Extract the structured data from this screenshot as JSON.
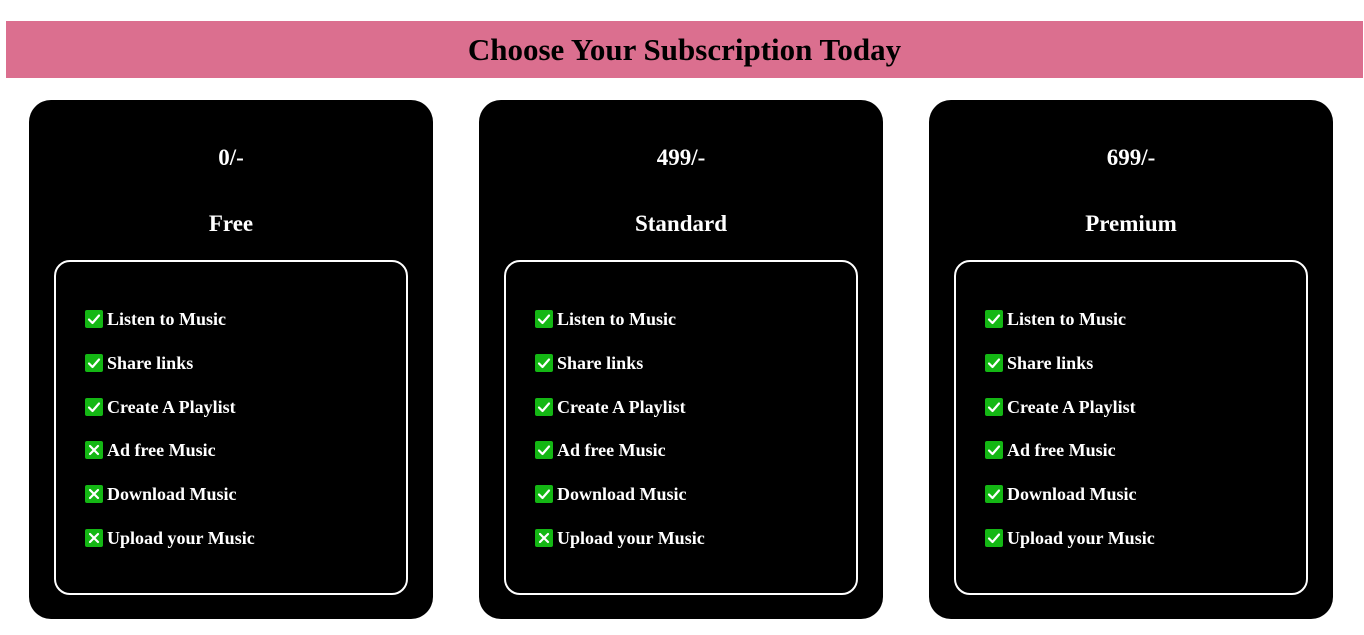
{
  "header": {
    "title": "Choose Your Subscription Today"
  },
  "colors": {
    "header_bg": "#db6f8f",
    "card_bg": "#000000",
    "check_bg": "#14b714"
  },
  "plans": [
    {
      "price": "0/-",
      "name": "Free",
      "features": [
        {
          "label": "Listen to Music",
          "icon": "check-icon"
        },
        {
          "label": "Share links",
          "icon": "check-icon"
        },
        {
          "label": "Create A Playlist",
          "icon": "check-icon"
        },
        {
          "label": "Ad free Music",
          "icon": "cross-icon"
        },
        {
          "label": "Download Music",
          "icon": "cross-icon"
        },
        {
          "label": "Upload your Music",
          "icon": "cross-icon"
        }
      ]
    },
    {
      "price": "499/-",
      "name": "Standard",
      "features": [
        {
          "label": "Listen to Music",
          "icon": "check-icon"
        },
        {
          "label": "Share links",
          "icon": "check-icon"
        },
        {
          "label": "Create A Playlist",
          "icon": "check-icon"
        },
        {
          "label": "Ad free Music",
          "icon": "check-icon"
        },
        {
          "label": "Download Music",
          "icon": "check-icon"
        },
        {
          "label": "Upload your Music",
          "icon": "cross-icon"
        }
      ]
    },
    {
      "price": "699/-",
      "name": "Premium",
      "features": [
        {
          "label": "Listen to Music",
          "icon": "check-icon"
        },
        {
          "label": "Share links",
          "icon": "check-icon"
        },
        {
          "label": "Create A Playlist",
          "icon": "check-icon"
        },
        {
          "label": "Ad free Music",
          "icon": "check-icon"
        },
        {
          "label": "Download Music",
          "icon": "check-icon"
        },
        {
          "label": "Upload your Music",
          "icon": "check-icon"
        }
      ]
    }
  ]
}
